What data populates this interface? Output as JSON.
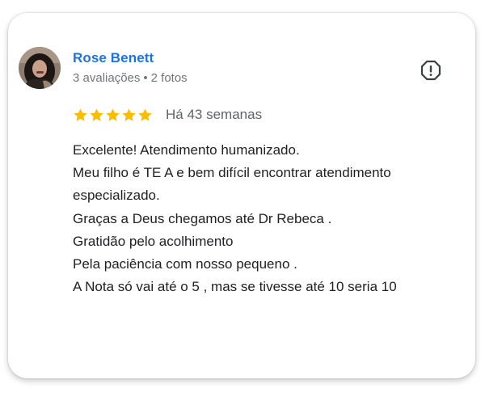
{
  "review": {
    "author_name": "Rose Benett",
    "reviews_count": "3 avaliações",
    "separator": "•",
    "photos_count": "2 fotos",
    "rating": 5,
    "rating_max": 5,
    "star_color": "#fbbc04",
    "time_ago": "Há 43 semanas",
    "report_icon": "report-flag-icon",
    "text_lines": [
      "Excelente! Atendimento humanizado.",
      "Meu filho é TE A e bem difícil encontrar atendimento",
      "especializado.",
      "Graças a Deus chegamos até Dr Rebeca .",
      "Gratidão pelo acolhimento",
      "Pela paciência com nosso pequeno .",
      "A Nota só vai até o 5 , mas se tivesse até 10 seria 10"
    ]
  },
  "colors": {
    "name": "#1a73e8",
    "meta": "#70757a",
    "text": "#202124"
  }
}
